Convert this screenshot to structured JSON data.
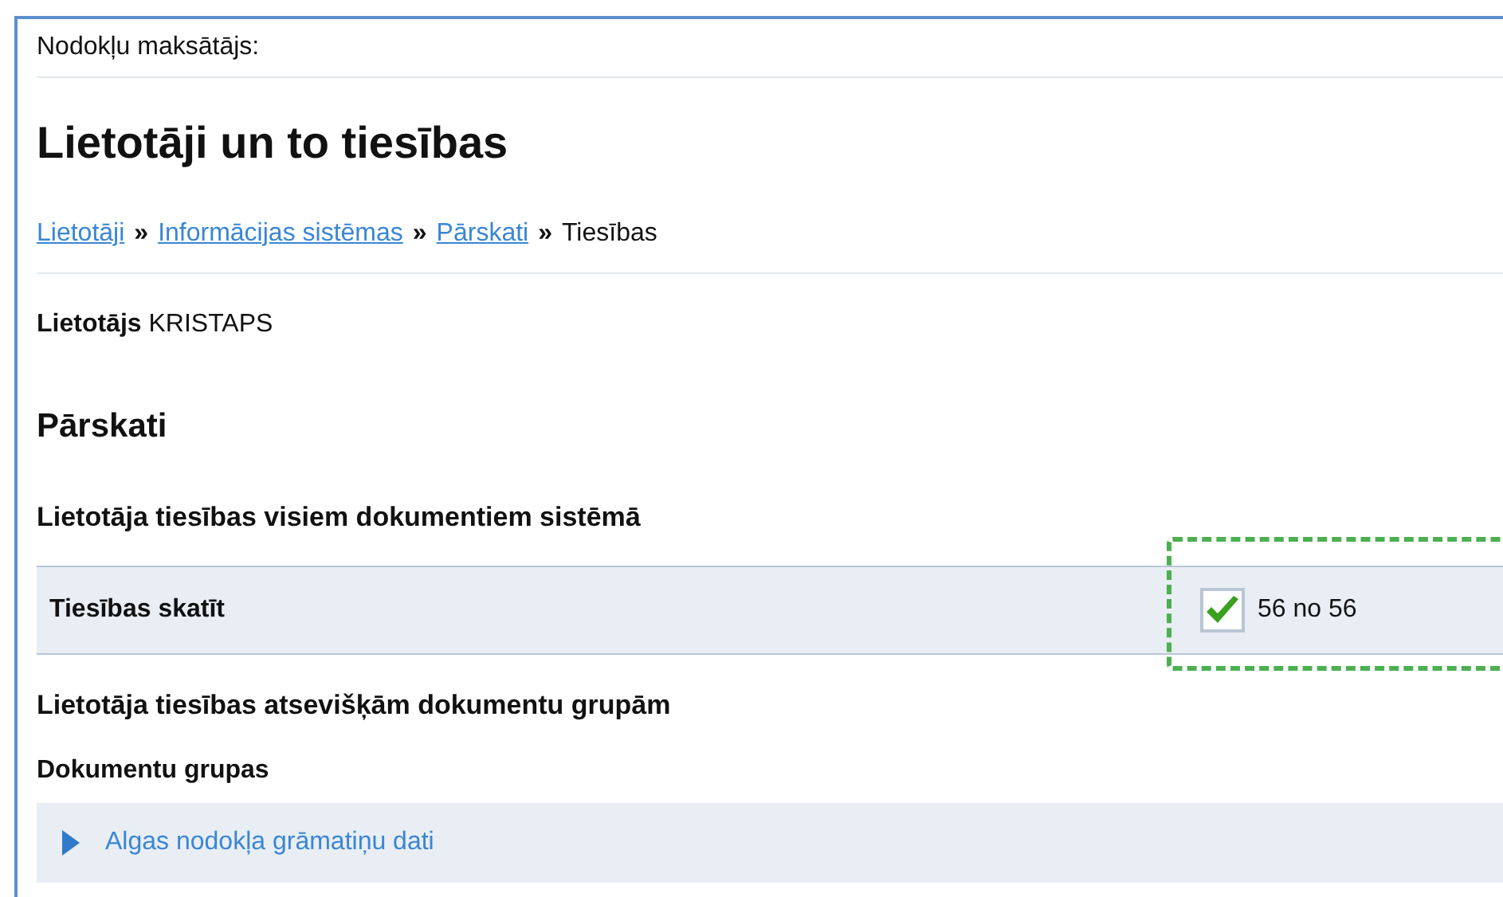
{
  "taxpayer_label": "Nodokļu maksātājs:",
  "title": "Lietotāji un to tiesības",
  "breadcrumb": [
    {
      "label": "Lietotāji",
      "link": true
    },
    {
      "label": "Informācijas sistēmas",
      "link": true
    },
    {
      "label": "Pārskati",
      "link": true
    },
    {
      "label": "Tiesības",
      "link": false
    }
  ],
  "breadcrumb_separator": "»",
  "user": {
    "label": "Lietotājs",
    "value": "KRISTAPS"
  },
  "section_title": "Pārskati",
  "all_documents": {
    "heading": "Lietotāja tiesības visiem dokumentiem sistēmā",
    "rows": [
      {
        "label": "Tiesības skatīt",
        "checked": true,
        "count": "56 no 56"
      }
    ]
  },
  "groups": {
    "heading": "Lietotāja tiesības atsevišķām dokumentu grupām",
    "subheading": "Dokumentu grupas",
    "items": [
      {
        "label": "Algas nodokļa grāmatiņu dati",
        "expanded": false
      }
    ]
  }
}
